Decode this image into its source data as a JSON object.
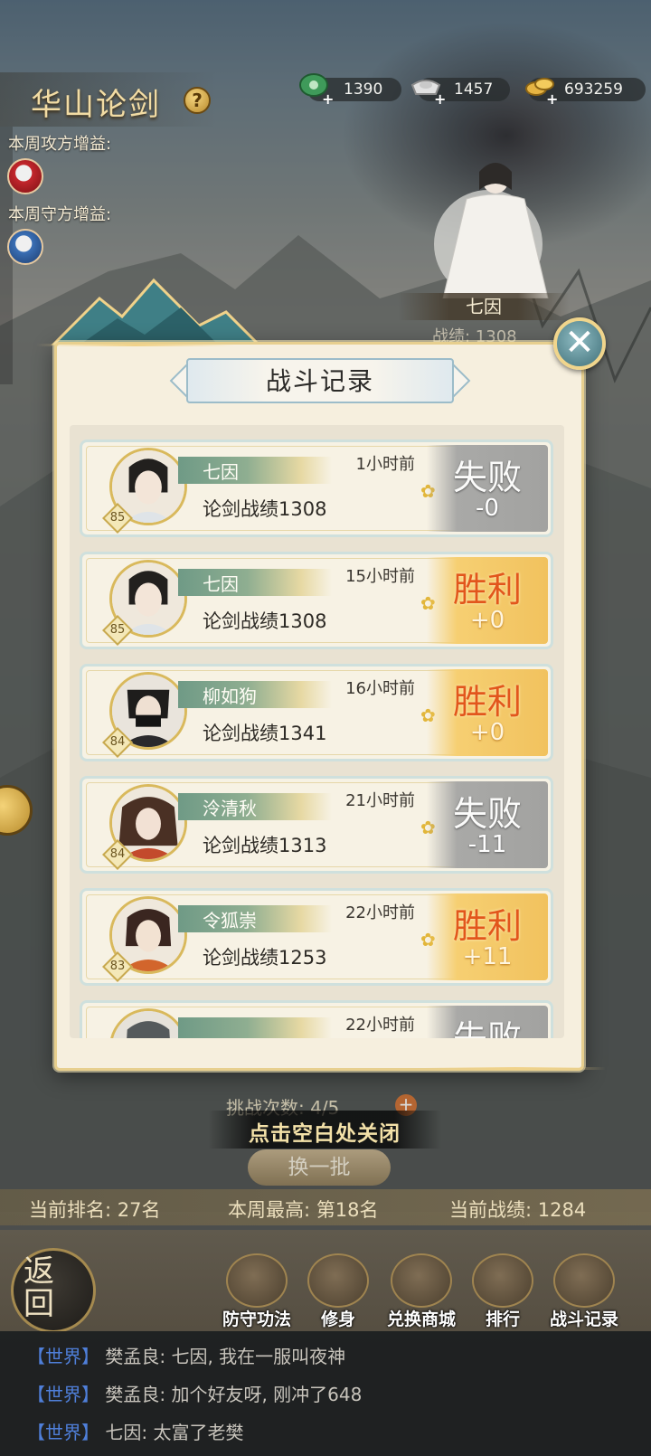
{
  "header": {
    "title": "华山论剑",
    "help_icon": "question-icon",
    "attack_buff_label": "本周攻方增益:",
    "defense_buff_label": "本周守方增益:"
  },
  "resources": [
    {
      "icon": "jade-token-icon",
      "value": "1390"
    },
    {
      "icon": "silver-ingot-icon",
      "value": "1457"
    },
    {
      "icon": "gold-coins-icon",
      "value": "693259"
    }
  ],
  "champion": {
    "name": "七因",
    "score_label": "战绩: 1308"
  },
  "modal": {
    "title": "战斗记录",
    "records": [
      {
        "name": "七因",
        "level": "85",
        "time": "1小时前",
        "score": "论剑战绩1308",
        "result": "失败",
        "delta": "-0",
        "outcome": "lose"
      },
      {
        "name": "七因",
        "level": "85",
        "time": "15小时前",
        "score": "论剑战绩1308",
        "result": "胜利",
        "delta": "+0",
        "outcome": "win"
      },
      {
        "name": "柳如狗",
        "level": "84",
        "time": "16小时前",
        "score": "论剑战绩1341",
        "result": "胜利",
        "delta": "+0",
        "outcome": "win"
      },
      {
        "name": "泠清秋",
        "level": "84",
        "time": "21小时前",
        "score": "论剑战绩1313",
        "result": "失败",
        "delta": "-11",
        "outcome": "lose"
      },
      {
        "name": "令狐崇",
        "level": "83",
        "time": "22小时前",
        "score": "论剑战绩1253",
        "result": "胜利",
        "delta": "+11",
        "outcome": "win"
      },
      {
        "name": "",
        "level": "",
        "time": "22小时前",
        "score": "",
        "result": "失败",
        "delta": "",
        "outcome": "lose"
      }
    ]
  },
  "bottom": {
    "challenge_count": "挑战次数: 4/5",
    "tap_to_close": "点击空白处关闭",
    "refresh_label": "换一批",
    "current_rank": "当前排名: 27名",
    "weekly_best": "本周最高: 第18名",
    "current_score": "当前战绩: 1284"
  },
  "nav": {
    "back": "返回",
    "items": [
      {
        "label": "防守功法",
        "icon": "scroll-books-icon"
      },
      {
        "label": "修身",
        "icon": "sword-book-icon"
      },
      {
        "label": "兑换商城",
        "icon": "coin-shop-icon"
      },
      {
        "label": "排行",
        "icon": "ranking-banner-icon"
      },
      {
        "label": "战斗记录",
        "icon": "battle-scroll-icon"
      }
    ]
  },
  "chat": [
    {
      "channel": "【世界】",
      "text": "樊孟良: 七因, 我在一服叫夜神"
    },
    {
      "channel": "【世界】",
      "text": "樊孟良: 加个好友呀, 刚冲了648"
    },
    {
      "channel": "【世界】",
      "text": "七因: 太富了老樊"
    }
  ]
}
